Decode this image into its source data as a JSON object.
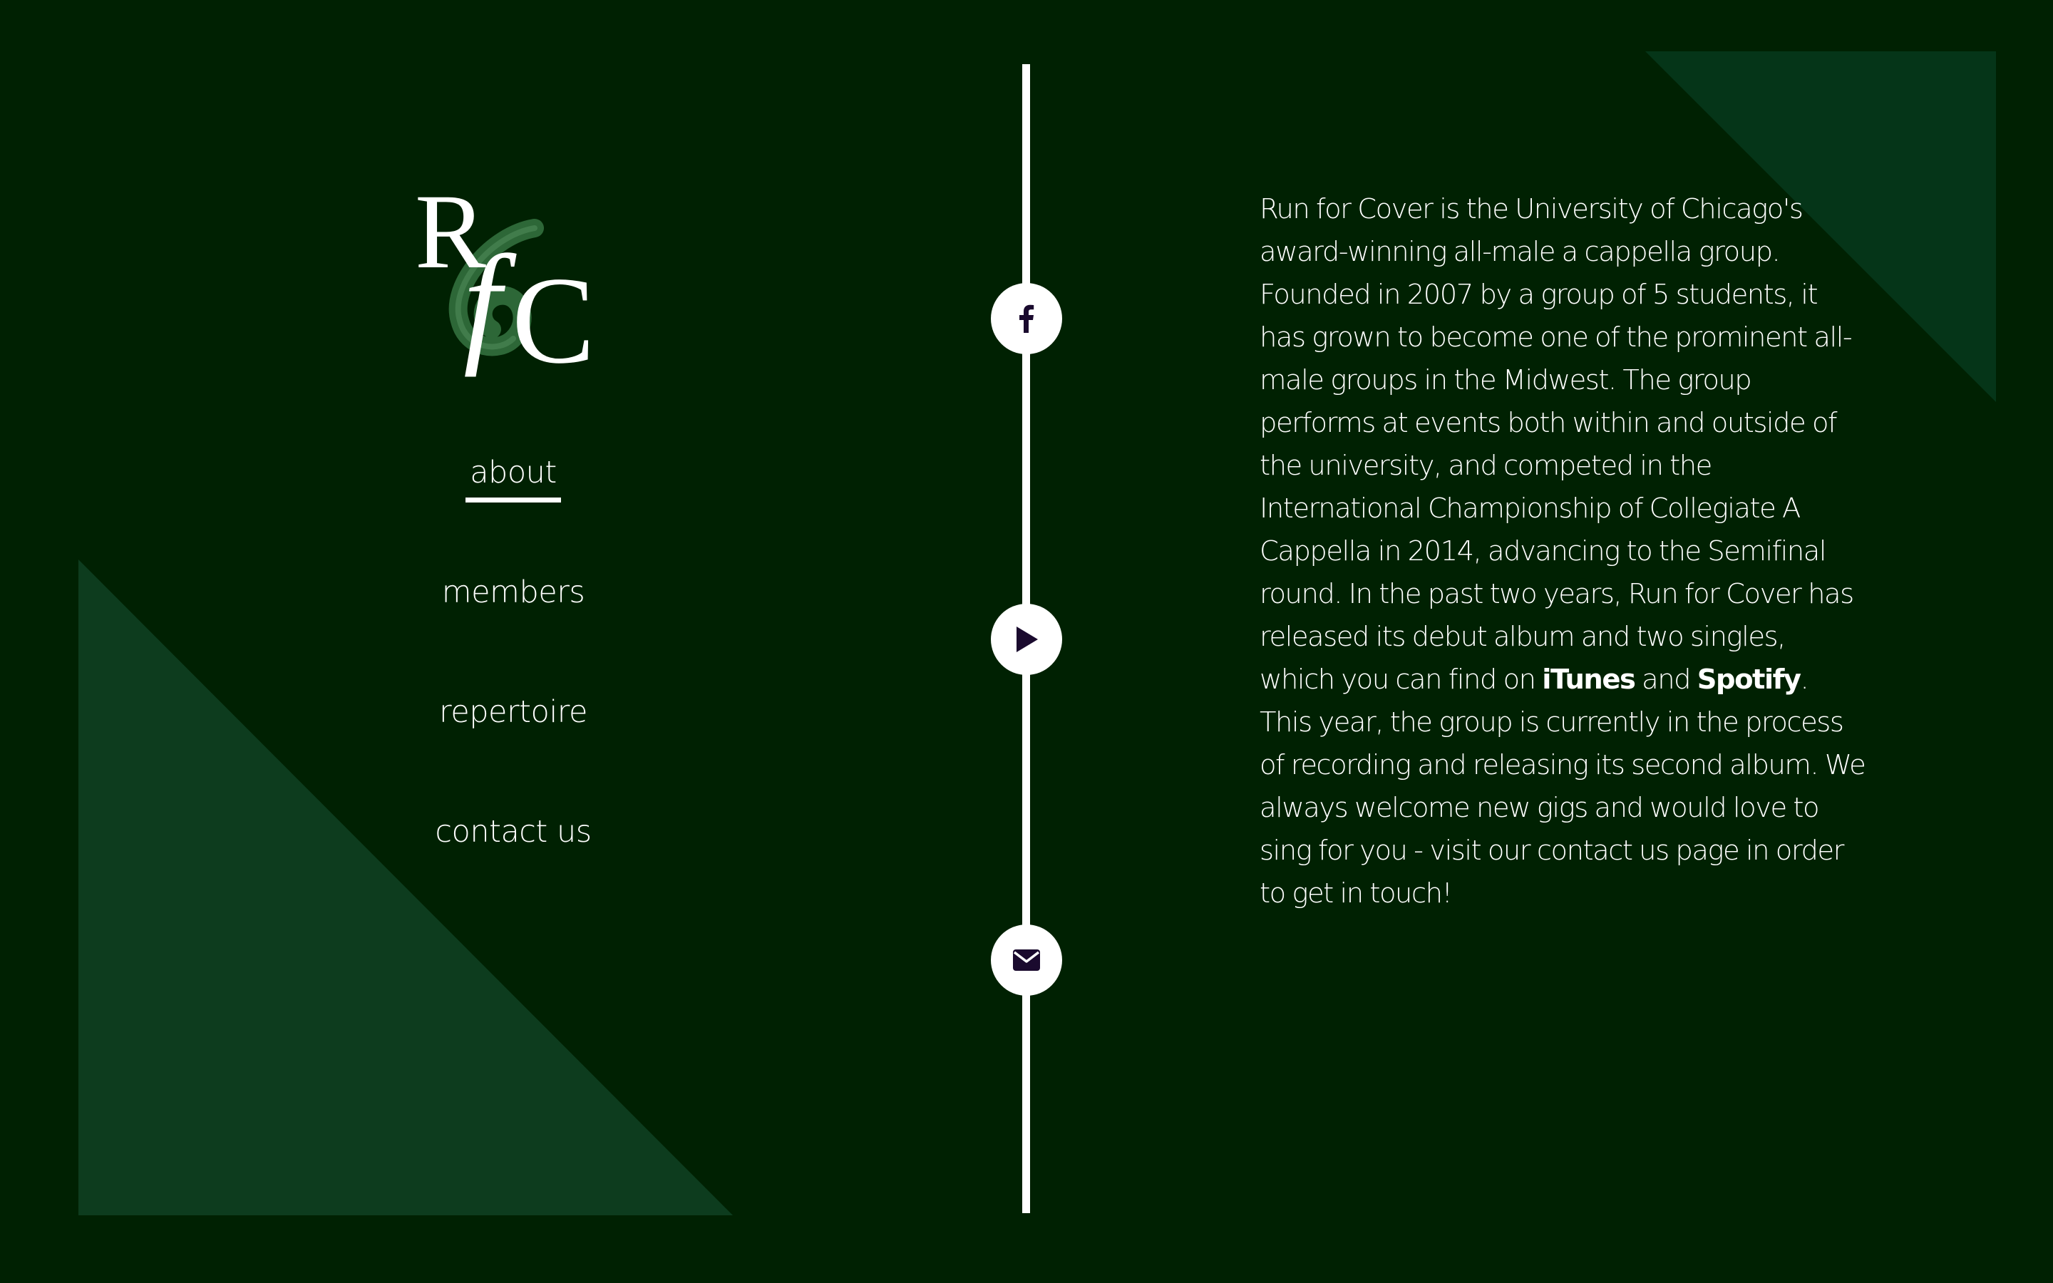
{
  "logo": {
    "letters": "RfC",
    "alt": "Run for Cover logo"
  },
  "nav": {
    "items": [
      {
        "label": "about",
        "active": true
      },
      {
        "label": "members",
        "active": false
      },
      {
        "label": "repertoire",
        "active": false
      },
      {
        "label": "contact us",
        "active": false
      }
    ]
  },
  "social": {
    "icons": [
      "facebook-icon",
      "play-icon",
      "envelope-icon"
    ],
    "icon_color": "#1a0a2e"
  },
  "about": {
    "text_1": "Run for Cover is the University of Chicago's award-winning all-male a cappella group. Founded in 2007 by a group of 5 students, it has grown to become one of the prominent all-male groups in the Midwest. The group performs at events both within and outside of the university, and competed in the International Championship of Collegiate A Cappella in 2014, advancing to the Semifinal round. In the past two years, Run for Cover has released its debut album and two singles, which you can find on ",
    "link_itunes": "iTunes",
    "text_2": " and ",
    "link_spotify": "Spotify",
    "text_3": ". This year, the group is currently in the process of recording and releasing its second album. We always welcome new gigs and would love to sing for you - visit our contact us page in order to get in touch!"
  },
  "colors": {
    "background": "#002102",
    "triangle_left": "#0d3c1e",
    "triangle_right": "#053518",
    "foreground": "#ffffff"
  }
}
